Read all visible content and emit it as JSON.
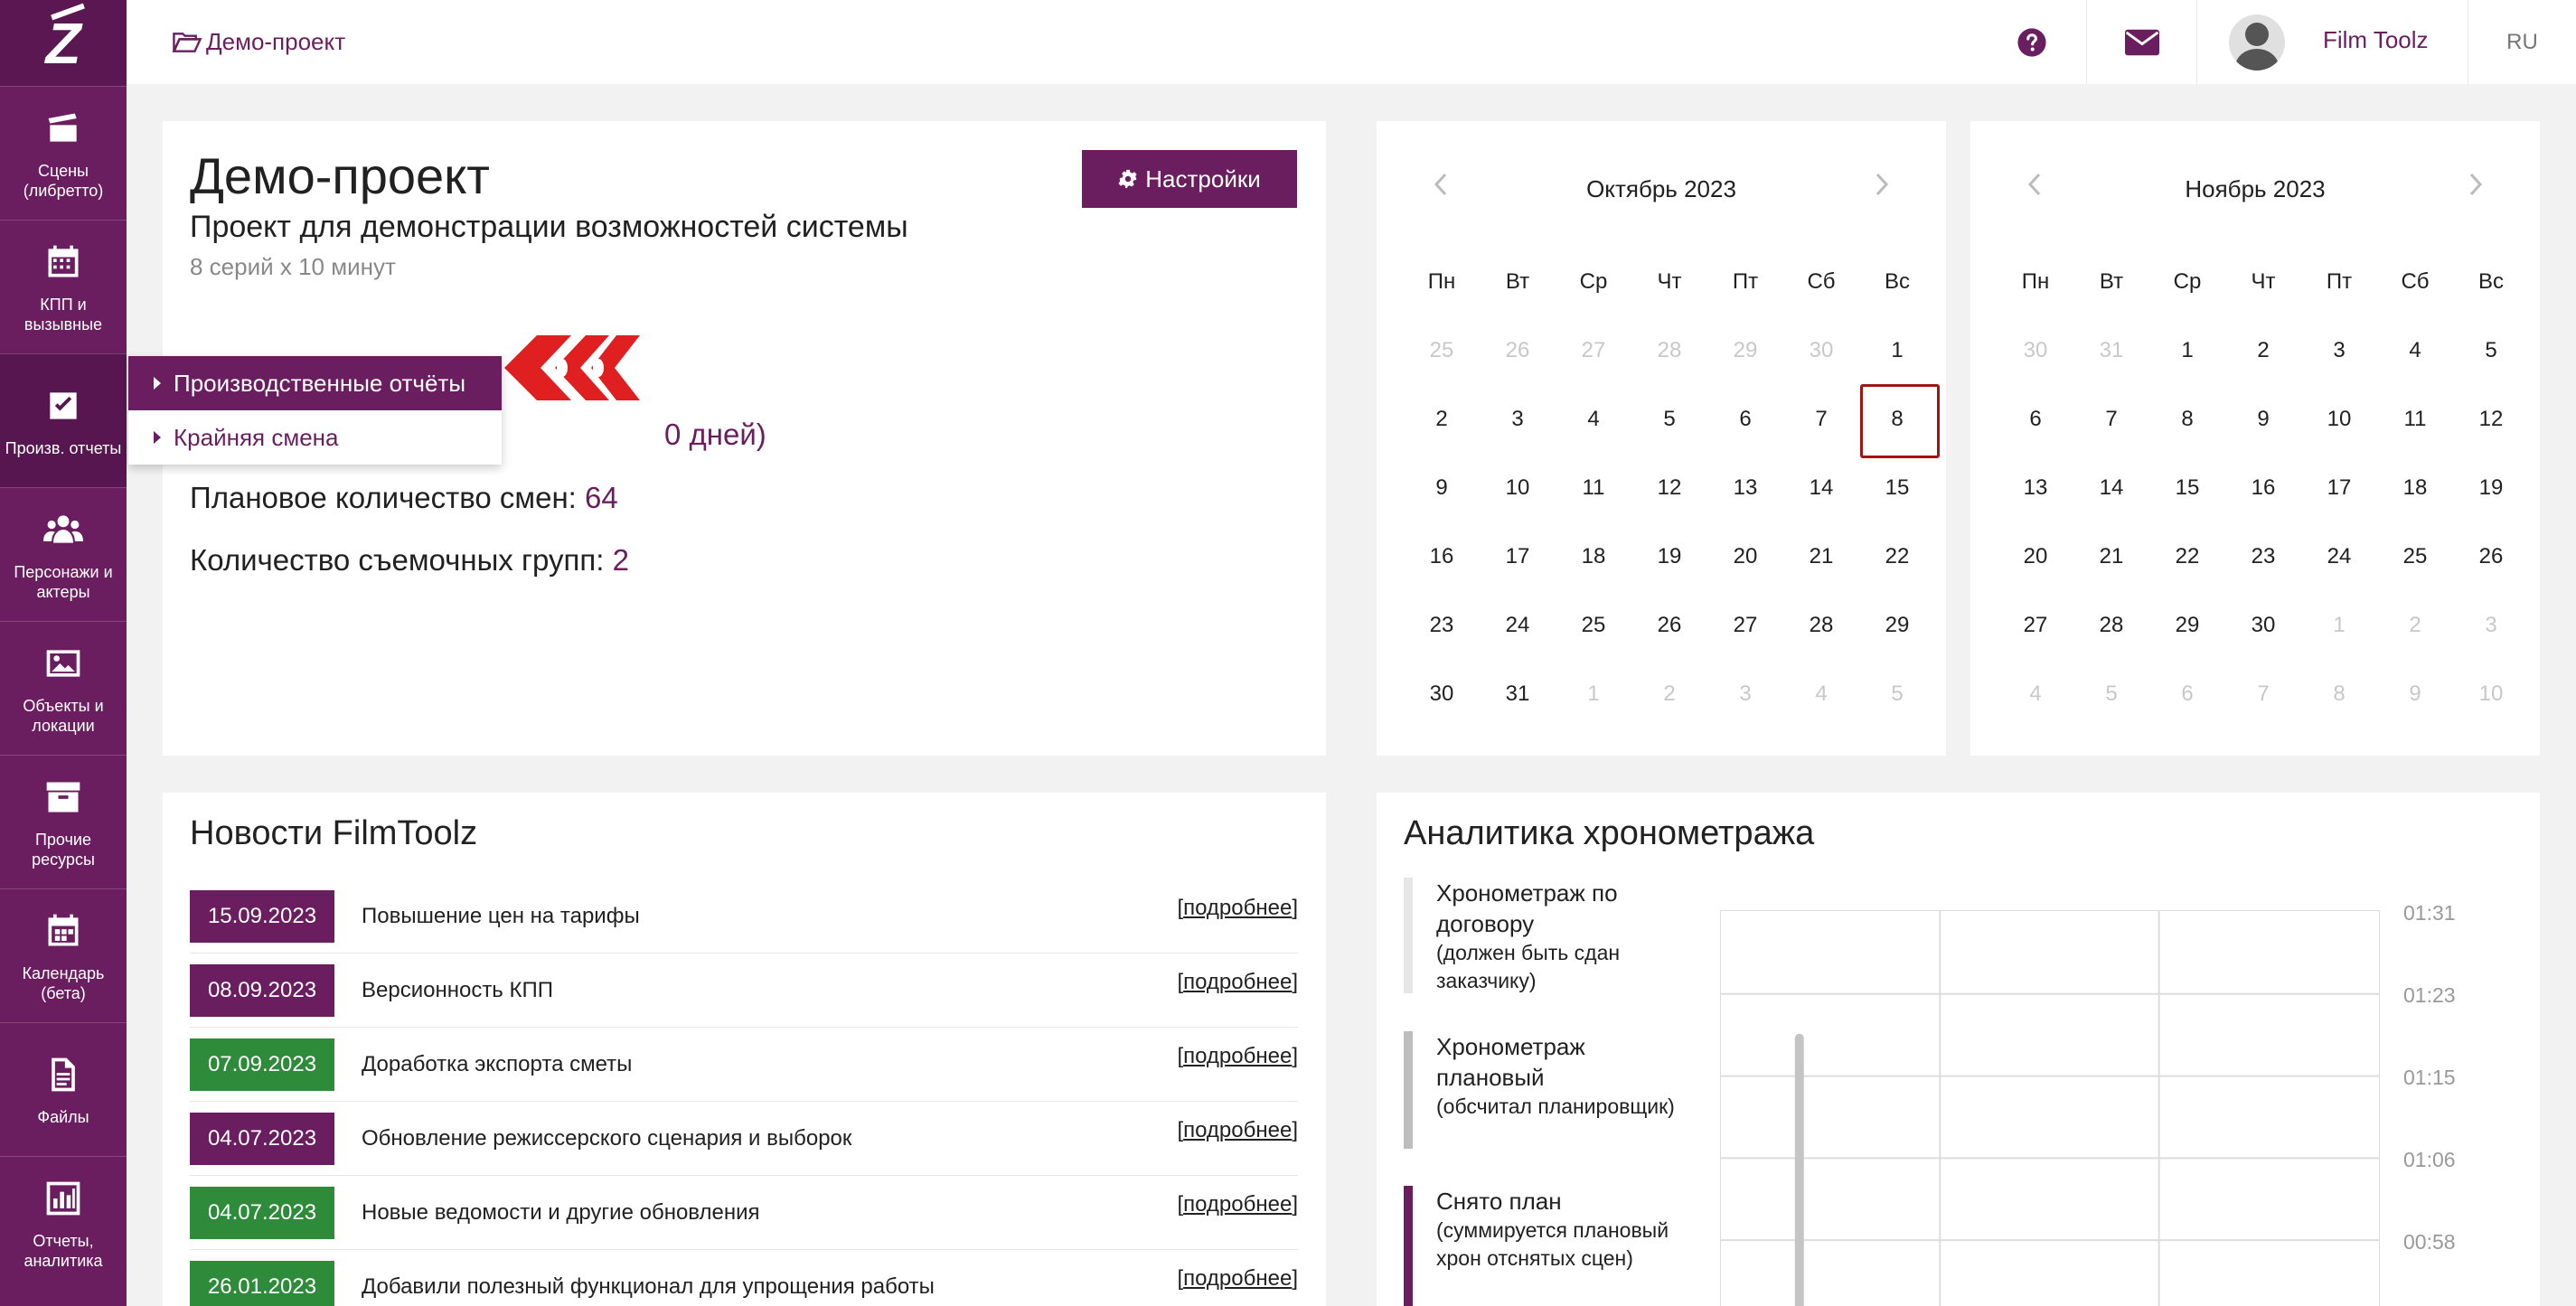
{
  "sidebar": {
    "logo": "Z",
    "items": [
      {
        "label": "Сцены (либретто)",
        "icon": "clapperboard-icon"
      },
      {
        "label": "КПП и вызывные",
        "icon": "calendar-grid-icon"
      },
      {
        "label": "Произв. отчеты",
        "icon": "checkbox-icon"
      },
      {
        "label": "Персонажи и актеры",
        "icon": "users-icon"
      },
      {
        "label": "Объекты и локации",
        "icon": "image-icon"
      },
      {
        "label": "Прочие ресурсы",
        "icon": "archive-icon"
      },
      {
        "label": "Календарь (бета)",
        "icon": "calendar-icon"
      },
      {
        "label": "Файлы",
        "icon": "file-icon"
      },
      {
        "label": "Отчеты, аналитика",
        "icon": "bar-chart-icon"
      }
    ]
  },
  "topbar": {
    "breadcrumb": "Демо-проект",
    "username": "Film Toolz",
    "language": "RU"
  },
  "dropdown": {
    "items": [
      "Производственные отчёты",
      "Крайняя смена"
    ]
  },
  "project": {
    "title": "Демо-проект",
    "subtitle": "Проект для демонстрации возможностей системы",
    "meta": "8 серий х 10 минут",
    "settings_label": "Настройки",
    "days_partial": "0 дней)",
    "planned_shifts_label": "Плановое количество смен: ",
    "planned_shifts_value": "64",
    "crews_label": "Количество съемочных групп: ",
    "crews_value": "2"
  },
  "calendars": [
    {
      "month": "Октябрь 2023",
      "weekdays": [
        "Пн",
        "Вт",
        "Ср",
        "Чт",
        "Пт",
        "Сб",
        "Вс"
      ],
      "days": [
        [
          "25",
          1
        ],
        [
          "26",
          1
        ],
        [
          "27",
          1
        ],
        [
          "28",
          1
        ],
        [
          "29",
          1
        ],
        [
          "30",
          1
        ],
        [
          "1",
          0
        ],
        [
          "2",
          0
        ],
        [
          "3",
          0
        ],
        [
          "4",
          0
        ],
        [
          "5",
          0
        ],
        [
          "6",
          0
        ],
        [
          "7",
          0
        ],
        [
          "8",
          2
        ],
        [
          "9",
          0
        ],
        [
          "10",
          0
        ],
        [
          "11",
          0
        ],
        [
          "12",
          0
        ],
        [
          "13",
          0
        ],
        [
          "14",
          0
        ],
        [
          "15",
          0
        ],
        [
          "16",
          0
        ],
        [
          "17",
          0
        ],
        [
          "18",
          0
        ],
        [
          "19",
          0
        ],
        [
          "20",
          0
        ],
        [
          "21",
          0
        ],
        [
          "22",
          0
        ],
        [
          "23",
          0
        ],
        [
          "24",
          0
        ],
        [
          "25",
          0
        ],
        [
          "26",
          0
        ],
        [
          "27",
          0
        ],
        [
          "28",
          0
        ],
        [
          "29",
          0
        ],
        [
          "30",
          0
        ],
        [
          "31",
          0
        ],
        [
          "1",
          1
        ],
        [
          "2",
          1
        ],
        [
          "3",
          1
        ],
        [
          "4",
          1
        ],
        [
          "5",
          1
        ]
      ]
    },
    {
      "month": "Ноябрь 2023",
      "weekdays": [
        "Пн",
        "Вт",
        "Ср",
        "Чт",
        "Пт",
        "Сб",
        "Вс"
      ],
      "days": [
        [
          "30",
          1
        ],
        [
          "31",
          1
        ],
        [
          "1",
          0
        ],
        [
          "2",
          0
        ],
        [
          "3",
          0
        ],
        [
          "4",
          0
        ],
        [
          "5",
          0
        ],
        [
          "6",
          0
        ],
        [
          "7",
          0
        ],
        [
          "8",
          0
        ],
        [
          "9",
          0
        ],
        [
          "10",
          0
        ],
        [
          "11",
          0
        ],
        [
          "12",
          0
        ],
        [
          "13",
          0
        ],
        [
          "14",
          0
        ],
        [
          "15",
          0
        ],
        [
          "16",
          0
        ],
        [
          "17",
          0
        ],
        [
          "18",
          0
        ],
        [
          "19",
          0
        ],
        [
          "20",
          0
        ],
        [
          "21",
          0
        ],
        [
          "22",
          0
        ],
        [
          "23",
          0
        ],
        [
          "24",
          0
        ],
        [
          "25",
          0
        ],
        [
          "26",
          0
        ],
        [
          "27",
          0
        ],
        [
          "28",
          0
        ],
        [
          "29",
          0
        ],
        [
          "30",
          0
        ],
        [
          "1",
          1
        ],
        [
          "2",
          1
        ],
        [
          "3",
          1
        ],
        [
          "4",
          1
        ],
        [
          "5",
          1
        ],
        [
          "6",
          1
        ],
        [
          "7",
          1
        ],
        [
          "8",
          1
        ],
        [
          "9",
          1
        ],
        [
          "10",
          1
        ]
      ]
    }
  ],
  "news": {
    "title": "Новости FilmToolz",
    "more_label": "подробнее",
    "colors": {
      "purple": "#6b1e5f",
      "green": "#2e8b3a"
    },
    "items": [
      {
        "date": "15.09.2023",
        "text": "Повышение цен на тарифы",
        "color": "purple"
      },
      {
        "date": "08.09.2023",
        "text": "Версионность КПП",
        "color": "purple"
      },
      {
        "date": "07.09.2023",
        "text": "Доработка экспорта сметы",
        "color": "green"
      },
      {
        "date": "04.07.2023",
        "text": "Обновление режиссерского сценария и выборок",
        "color": "purple"
      },
      {
        "date": "04.07.2023",
        "text": "Новые ведомости и другие обновления",
        "color": "green"
      },
      {
        "date": "26.01.2023",
        "text": "Добавили полезный функционал для упрощения работы",
        "color": "green"
      }
    ]
  },
  "analytics": {
    "title": "Аналитика хронометража",
    "legend": [
      {
        "main": "Хронометраж по договору",
        "sub": "(должен быть сдан заказчику)",
        "color": "#e6e6e6"
      },
      {
        "main": "Хронометраж плановый",
        "sub": "(обсчитал планировщик)",
        "color": "#bdbdbd"
      },
      {
        "main": "Снято план",
        "sub": "(суммируется плановый хрон отснятых сцен)",
        "color": "#6b1e5f"
      }
    ],
    "y_ticks": [
      "01:31",
      "01:23",
      "01:15",
      "01:06",
      "00:58"
    ]
  },
  "colors": {
    "accent": "#6b1e5f",
    "today_border": "#a31515"
  }
}
